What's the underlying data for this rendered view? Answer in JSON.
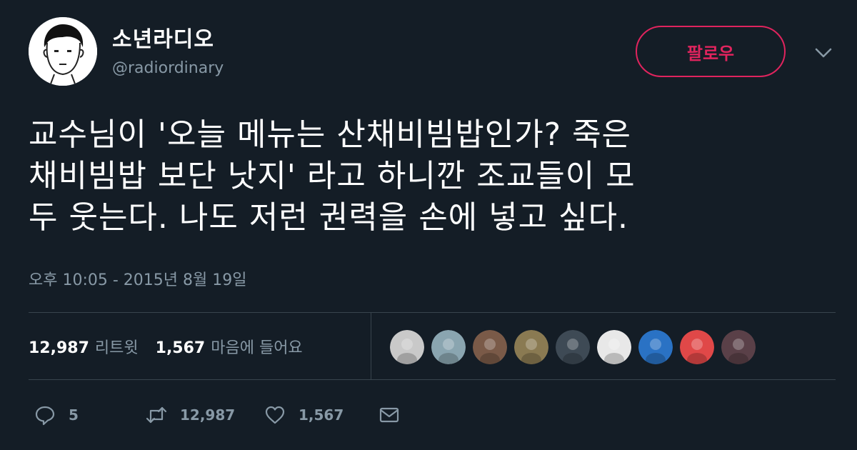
{
  "user": {
    "display_name": "소년라디오",
    "handle": "@radiordinary",
    "avatar_icon": "cartoon-face-avatar"
  },
  "follow_label": "팔로우",
  "more_icon": "chevron-down-icon",
  "tweet": {
    "text": "교수님이 '오늘 메뉴는 산채비빔밥인가? 죽은\n채비빔밥 보단 낫지' 라고 하니깐 조교들이 모\n두 웃는다. 나도 저런 권력을 손에 넣고 싶다.",
    "timestamp": "오후 10:05 - 2015년 8월 19일"
  },
  "stats": {
    "retweets_count": "12,987",
    "retweets_label": "리트윗",
    "likes_count": "1,567",
    "likes_label": "마음에 들어요"
  },
  "liker_avatars": [
    {
      "name": "liker-avatar-1",
      "color": "#c9c9c9"
    },
    {
      "name": "liker-avatar-2",
      "color": "#8aa5b0"
    },
    {
      "name": "liker-avatar-3",
      "color": "#7a5a48"
    },
    {
      "name": "liker-avatar-4",
      "color": "#8a7a52"
    },
    {
      "name": "liker-avatar-5",
      "color": "#3e4a55"
    },
    {
      "name": "liker-avatar-6",
      "color": "#e8e8e8"
    },
    {
      "name": "liker-avatar-7",
      "color": "#2a72c4"
    },
    {
      "name": "liker-avatar-8",
      "color": "#e04848"
    },
    {
      "name": "liker-avatar-9",
      "color": "#5a4048"
    }
  ],
  "actions": {
    "reply_count": "5",
    "retweet_count": "12,987",
    "like_count": "1,567"
  },
  "colors": {
    "background": "#141d26",
    "accent": "#e0245e",
    "secondary_text": "#8899a6",
    "divider": "#38444d"
  }
}
